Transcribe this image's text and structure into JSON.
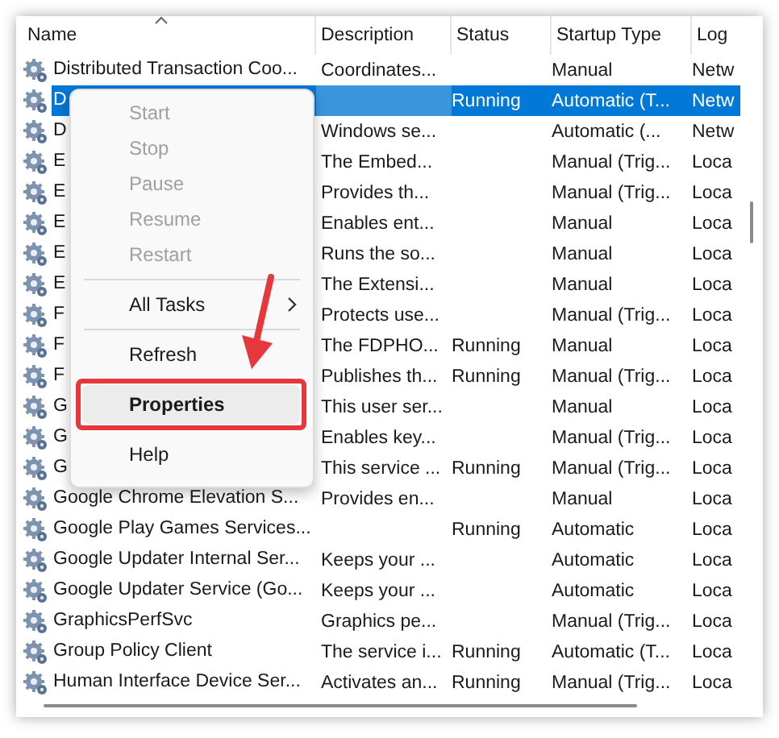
{
  "table": {
    "columns": [
      {
        "label": "Name",
        "sorted": true
      },
      {
        "label": "Description"
      },
      {
        "label": "Status"
      },
      {
        "label": "Startup Type"
      },
      {
        "label": "Log"
      }
    ],
    "rows": [
      {
        "name": "Distributed Transaction Coo...",
        "description": "Coordinates...",
        "status": "",
        "startup": "Manual",
        "log": "Netw",
        "selected": false
      },
      {
        "name": "D",
        "description": "",
        "status": "Running",
        "startup": "Automatic (T...",
        "log": "Netw",
        "selected": true
      },
      {
        "name": "D",
        "description": "Windows se...",
        "status": "",
        "startup": "Automatic (...",
        "log": "Netw",
        "selected": false
      },
      {
        "name": "E",
        "description": "The Embed...",
        "status": "",
        "startup": "Manual (Trig...",
        "log": "Loca",
        "selected": false
      },
      {
        "name": "E",
        "description": "Provides th...",
        "status": "",
        "startup": "Manual (Trig...",
        "log": "Loca",
        "selected": false
      },
      {
        "name": "E",
        "description": "Enables ent...",
        "status": "",
        "startup": "Manual",
        "log": "Loca",
        "selected": false
      },
      {
        "name": "E",
        "description": "Runs the so...",
        "status": "",
        "startup": "Manual",
        "log": "Loca",
        "selected": false
      },
      {
        "name": "E",
        "description": "The Extensi...",
        "status": "",
        "startup": "Manual",
        "log": "Loca",
        "selected": false
      },
      {
        "name": "F",
        "description": "Protects use...",
        "status": "",
        "startup": "Manual (Trig...",
        "log": "Loca",
        "selected": false
      },
      {
        "name": "F",
        "description": "The FDPHO...",
        "status": "Running",
        "startup": "Manual",
        "log": "Loca",
        "selected": false
      },
      {
        "name": "F",
        "description": "Publishes th...",
        "status": "Running",
        "startup": "Manual (Trig...",
        "log": "Loca",
        "selected": false
      },
      {
        "name": "G",
        "description": "This user ser...",
        "status": "",
        "startup": "Manual",
        "log": "Loca",
        "selected": false
      },
      {
        "name": "G",
        "description": "Enables key...",
        "status": "",
        "startup": "Manual (Trig...",
        "log": "Loca",
        "selected": false
      },
      {
        "name": "G",
        "description": "This service ...",
        "status": "Running",
        "startup": "Manual (Trig...",
        "log": "Loca",
        "selected": false
      },
      {
        "name": "Google Chrome Elevation S...",
        "description": "Provides en...",
        "status": "",
        "startup": "Manual",
        "log": "Loca",
        "selected": false
      },
      {
        "name": "Google Play Games Services...",
        "description": "",
        "status": "Running",
        "startup": "Automatic",
        "log": "Loca",
        "selected": false
      },
      {
        "name": "Google Updater Internal Ser...",
        "description": "Keeps your ...",
        "status": "",
        "startup": "Automatic",
        "log": "Loca",
        "selected": false
      },
      {
        "name": "Google Updater Service (Go...",
        "description": "Keeps your ...",
        "status": "",
        "startup": "Automatic",
        "log": "Loca",
        "selected": false
      },
      {
        "name": "GraphicsPerfSvc",
        "description": "Graphics pe...",
        "status": "",
        "startup": "Manual (Trig...",
        "log": "Loca",
        "selected": false
      },
      {
        "name": "Group Policy Client",
        "description": "The service i...",
        "status": "Running",
        "startup": "Automatic (T...",
        "log": "Loca",
        "selected": false
      },
      {
        "name": "Human Interface Device Ser...",
        "description": "Activates an...",
        "status": "Running",
        "startup": "Manual (Trig...",
        "log": "Loca",
        "selected": false
      }
    ]
  },
  "context_menu": {
    "items": [
      {
        "kind": "item",
        "label": "Start",
        "disabled": true,
        "selected": false
      },
      {
        "kind": "item",
        "label": "Stop",
        "disabled": true,
        "selected": false
      },
      {
        "kind": "item",
        "label": "Pause",
        "disabled": true,
        "selected": false
      },
      {
        "kind": "item",
        "label": "Resume",
        "disabled": true,
        "selected": false
      },
      {
        "kind": "item",
        "label": "Restart",
        "disabled": true,
        "selected": false
      },
      {
        "kind": "separator"
      },
      {
        "kind": "submenu",
        "label": "All Tasks",
        "disabled": false,
        "selected": false
      },
      {
        "kind": "separator"
      },
      {
        "kind": "item",
        "label": "Refresh",
        "disabled": false,
        "selected": false
      },
      {
        "kind": "item",
        "label": "Properties",
        "disabled": false,
        "selected": true,
        "default": true,
        "outlined": true
      },
      {
        "kind": "item",
        "label": "Help",
        "disabled": false,
        "selected": false
      }
    ]
  },
  "annotation_arrow": true
}
